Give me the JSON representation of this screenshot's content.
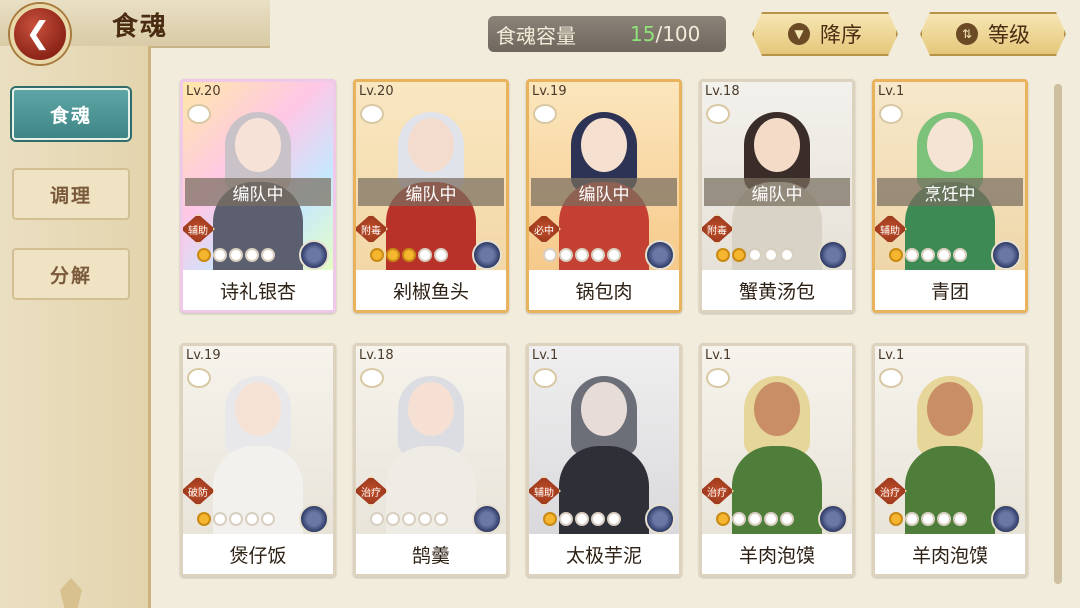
{
  "header": {
    "back_icon": "back-arrow-icon",
    "title": "食魂"
  },
  "capacity": {
    "label": "食魂容量",
    "current": "15",
    "max": "/100"
  },
  "sort_buttons": [
    {
      "label": "降序",
      "icon": "sort-down-icon"
    },
    {
      "label": "等级",
      "icon": "sort-toggle-icon"
    }
  ],
  "sidebar": {
    "items": [
      {
        "label": "食魂",
        "active": true
      },
      {
        "label": "调理",
        "active": false
      },
      {
        "label": "分解",
        "active": false
      }
    ]
  },
  "cards": [
    {
      "level": "Lv.20",
      "status": "编队中",
      "tag": "辅助",
      "stars": 1,
      "name": "诗礼银杏"
    },
    {
      "level": "Lv.20",
      "status": "编队中",
      "tag": "附毒",
      "stars": 3,
      "name": "剁椒鱼头"
    },
    {
      "level": "Lv.19",
      "status": "编队中",
      "tag": "必中",
      "stars": 0,
      "name": "锅包肉"
    },
    {
      "level": "Lv.18",
      "status": "编队中",
      "tag": "附毒",
      "stars": 2,
      "name": "蟹黄汤包"
    },
    {
      "level": "Lv.1",
      "status": "烹饪中",
      "tag": "辅助",
      "stars": 1,
      "name": "青团"
    },
    {
      "level": "Lv.19",
      "status": "",
      "tag": "破防",
      "stars": 1,
      "name": "煲仔饭"
    },
    {
      "level": "Lv.18",
      "status": "",
      "tag": "治疗",
      "stars": 0,
      "name": "鹄羹"
    },
    {
      "level": "Lv.1",
      "status": "",
      "tag": "辅助",
      "stars": 1,
      "name": "太极芋泥"
    },
    {
      "level": "Lv.1",
      "status": "",
      "tag": "治疗",
      "stars": 1,
      "name": "羊肉泡馍"
    },
    {
      "level": "Lv.1",
      "status": "",
      "tag": "治疗",
      "stars": 1,
      "name": "羊肉泡馍"
    }
  ],
  "colors": {
    "active_tab": "#4f9797",
    "capacity_current": "#8fe27a",
    "star_on": "#f5b52e",
    "back_button": "#a8382a"
  }
}
